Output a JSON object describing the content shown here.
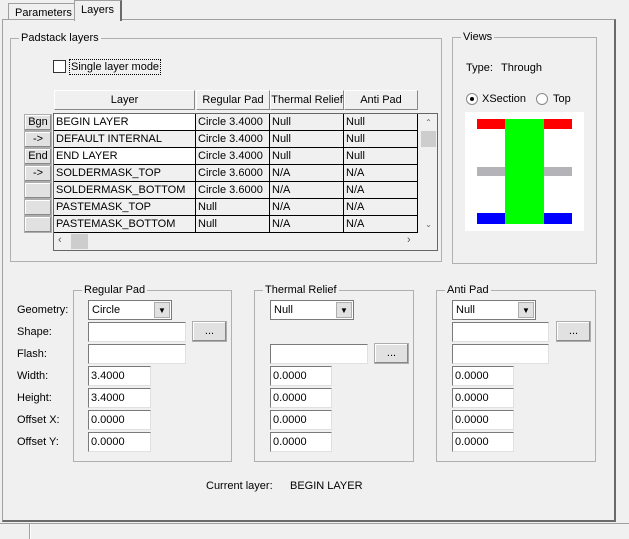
{
  "tabs": [
    {
      "label": "Parameters"
    },
    {
      "label": "Layers",
      "active": true
    }
  ],
  "padstack_layers": {
    "title": "Padstack layers",
    "single_layer_mode": {
      "label": "Single layer mode",
      "checked": false
    },
    "columns": [
      "Layer",
      "Regular Pad",
      "Thermal Relief",
      "Anti Pad"
    ],
    "side_buttons": [
      "Bgn",
      "->",
      "End",
      "->",
      "",
      "",
      ""
    ],
    "rows": [
      [
        "BEGIN LAYER",
        "Circle 3.4000",
        "Null",
        "Null"
      ],
      [
        "DEFAULT INTERNAL",
        "Circle 3.4000",
        "Null",
        "Null"
      ],
      [
        "END LAYER",
        "Circle 3.4000",
        "Null",
        "Null"
      ],
      [
        "SOLDERMASK_TOP",
        "Circle 3.6000",
        "N/A",
        "N/A"
      ],
      [
        "SOLDERMASK_BOTTOM",
        "Circle 3.6000",
        "N/A",
        "N/A"
      ],
      [
        "PASTEMASK_TOP",
        "Null",
        "N/A",
        "N/A"
      ],
      [
        "PASTEMASK_BOTTOM",
        "Null",
        "N/A",
        "N/A"
      ]
    ]
  },
  "views": {
    "title": "Views",
    "type_label": "Type:",
    "type_value": "Through",
    "radio_xsection": "XSection",
    "radio_top": "Top",
    "selected": "XSection",
    "colors": {
      "top": "#ff0000",
      "internal": "#b4b4b8",
      "bottom": "#0000ff",
      "drill": "#00ff00"
    }
  },
  "labels": {
    "geometry": "Geometry:",
    "shape": "Shape:",
    "flash": "Flash:",
    "width": "Width:",
    "height": "Height:",
    "offset_x": "Offset X:",
    "offset_y": "Offset Y:"
  },
  "regular_pad": {
    "title": "Regular Pad",
    "geometry": "Circle",
    "shape": "",
    "flash": "",
    "width": "3.4000",
    "height": "3.4000",
    "offset_x": "0.0000",
    "offset_y": "0.0000",
    "browse": "..."
  },
  "thermal_relief": {
    "title": "Thermal Relief",
    "geometry": "Null",
    "flash": "",
    "width": "0.0000",
    "height": "0.0000",
    "offset_x": "0.0000",
    "offset_y": "0.0000",
    "browse": "..."
  },
  "anti_pad": {
    "title": "Anti Pad",
    "geometry": "Null",
    "shape": "",
    "flash": "",
    "width": "0.0000",
    "height": "0.0000",
    "offset_x": "0.0000",
    "offset_y": "0.0000",
    "browse": "..."
  },
  "current_layer": {
    "label": "Current layer:",
    "value": "BEGIN LAYER"
  }
}
